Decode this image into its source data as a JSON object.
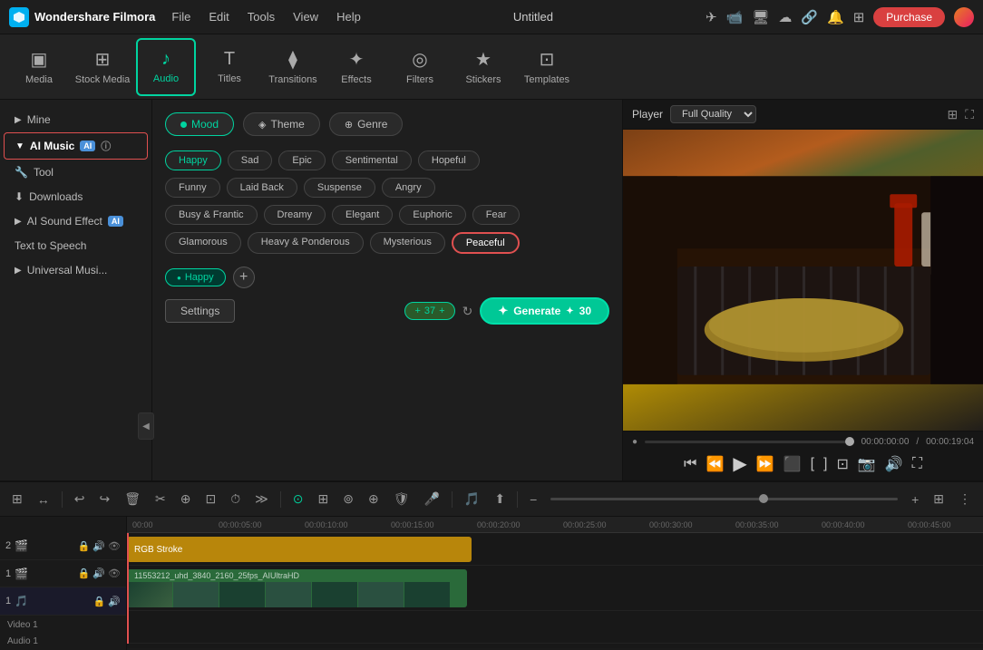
{
  "app": {
    "name": "Wondershare Filmora",
    "title": "Untitled",
    "purchase_btn": "Purchase"
  },
  "menu": {
    "items": [
      "File",
      "Edit",
      "Tools",
      "View",
      "Help"
    ]
  },
  "toolbar": {
    "items": [
      {
        "id": "media",
        "label": "Media",
        "icon": "▣"
      },
      {
        "id": "stock",
        "label": "Stock Media",
        "icon": "⊞"
      },
      {
        "id": "audio",
        "label": "Audio",
        "icon": "♪"
      },
      {
        "id": "titles",
        "label": "Titles",
        "icon": "T"
      },
      {
        "id": "transitions",
        "label": "Transitions",
        "icon": "⧫"
      },
      {
        "id": "effects",
        "label": "Effects",
        "icon": "✦"
      },
      {
        "id": "filters",
        "label": "Filters",
        "icon": "◎"
      },
      {
        "id": "stickers",
        "label": "Stickers",
        "icon": "😊"
      },
      {
        "id": "templates",
        "label": "Templates",
        "icon": "⊡"
      }
    ]
  },
  "sidebar": {
    "items": [
      {
        "id": "mine",
        "label": "Mine",
        "has_arrow": true
      },
      {
        "id": "ai-music",
        "label": "AI Music",
        "has_arrow": true,
        "has_ai": true,
        "active": true
      },
      {
        "id": "tool",
        "label": "Tool",
        "icon": "🔧"
      },
      {
        "id": "downloads",
        "label": "Downloads",
        "icon": "⬇"
      },
      {
        "id": "ai-sound",
        "label": "AI Sound Effect",
        "has_arrow": true,
        "has_ai": true
      },
      {
        "id": "tts",
        "label": "Text to Speech"
      },
      {
        "id": "universal",
        "label": "Universal Musi...",
        "has_arrow": true
      }
    ]
  },
  "audio_panel": {
    "tabs": [
      {
        "id": "mood",
        "label": "Mood"
      },
      {
        "id": "theme",
        "label": "Theme"
      },
      {
        "id": "genre",
        "label": "Genre"
      }
    ],
    "active_tab": "mood",
    "tags_row1": [
      "Happy",
      "Sad",
      "Epic",
      "Sentimental",
      "Hopeful"
    ],
    "tags_row2": [
      "Funny",
      "Laid Back",
      "Suspense",
      "Angry"
    ],
    "tags_row3": [
      "Busy & Frantic",
      "Dreamy",
      "Elegant",
      "Euphoric",
      "Fear"
    ],
    "tags_row4": [
      "Glamorous",
      "Heavy & Ponderous",
      "Mysterious",
      "Peaceful"
    ],
    "selected_tags": [
      "Happy"
    ],
    "add_tag_label": "+",
    "settings_label": "Settings",
    "count": "37",
    "count_plus": "+",
    "generate_label": "Generate",
    "generate_icon": "✦",
    "generate_count": "30"
  },
  "player": {
    "label": "Player",
    "quality": "Full Quality",
    "current_time": "00:00:00:00",
    "total_time": "00:00:19:04"
  },
  "timeline": {
    "ruler_marks": [
      "00:00",
      "00:00:05:00",
      "00:00:10:00",
      "00:00:15:00",
      "00:00:20:00",
      "00:00:25:00",
      "00:00:30:00",
      "00:00:35:00",
      "00:00:40:00",
      "00:00:45:00"
    ],
    "tracks": [
      {
        "id": "track2",
        "type": "video",
        "label": ""
      },
      {
        "id": "track1",
        "type": "video",
        "label": "Video 1"
      },
      {
        "id": "audio1",
        "type": "audio",
        "label": "Audio 1"
      }
    ],
    "clip_rgb_label": "RGB Stroke",
    "clip_video_label": "11553212_uhd_3840_2160_25fps_AIUltraHD"
  }
}
